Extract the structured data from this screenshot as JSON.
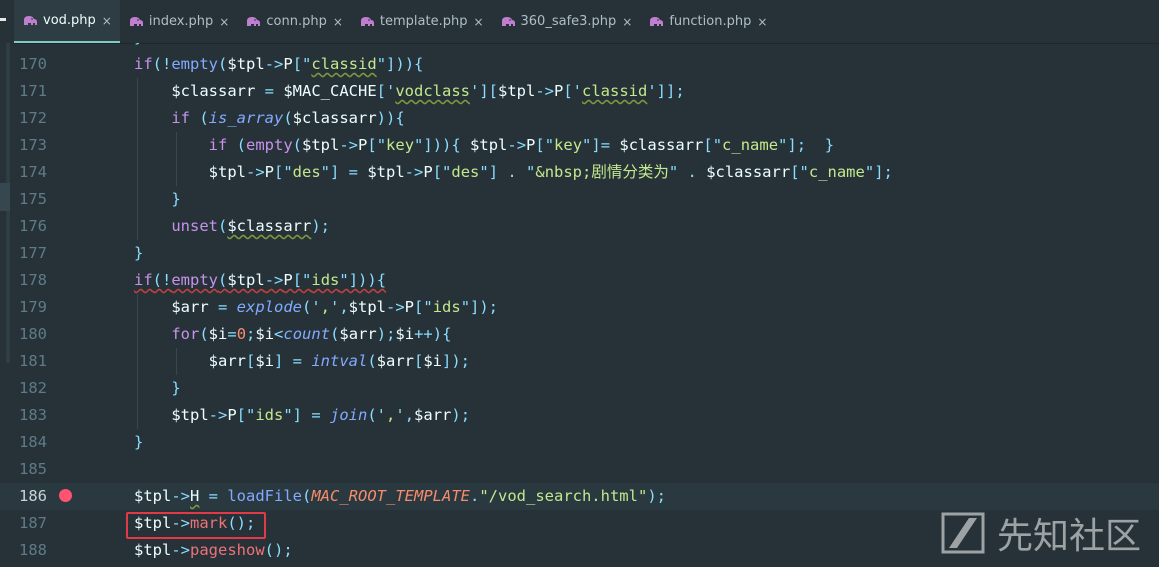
{
  "tabs": [
    {
      "label": "vod.php",
      "active": true
    },
    {
      "label": "index.php",
      "active": false
    },
    {
      "label": "conn.php",
      "active": false
    },
    {
      "label": "template.php",
      "active": false
    },
    {
      "label": "360_safe3.php",
      "active": false
    },
    {
      "label": "function.php",
      "active": false
    }
  ],
  "tab_close_glyph": "×",
  "lines": [
    {
      "num": "170",
      "tokens": [
        [
          "k",
          "if"
        ],
        [
          "o",
          "(!"
        ],
        [
          "f",
          "empty"
        ],
        [
          "o",
          "("
        ],
        [
          "v",
          "$tpl"
        ],
        [
          "o",
          "->"
        ],
        [
          "v",
          "P"
        ],
        [
          "o",
          "[\""
        ],
        [
          "s u",
          "classid"
        ],
        [
          "o",
          "\"])){"
        ]
      ]
    },
    {
      "num": "171",
      "tokens": [
        [
          "v",
          "    $classarr"
        ],
        [
          "o",
          " = "
        ],
        [
          "v",
          "$MAC_CACHE"
        ],
        [
          "o",
          "['"
        ],
        [
          "s u",
          "vodclass"
        ],
        [
          "o",
          "']["
        ],
        [
          "v",
          "$tpl"
        ],
        [
          "o",
          "->"
        ],
        [
          "v",
          "P"
        ],
        [
          "o",
          "['"
        ],
        [
          "s u",
          "classid"
        ],
        [
          "o",
          "']];"
        ]
      ]
    },
    {
      "num": "172",
      "tokens": [
        [
          "k",
          "    if"
        ],
        [
          "o",
          " ("
        ],
        [
          "fi",
          "is_array"
        ],
        [
          "o",
          "("
        ],
        [
          "v",
          "$classarr"
        ],
        [
          "o",
          "))"
        ],
        [
          "o",
          "{"
        ]
      ]
    },
    {
      "num": "173",
      "tokens": [
        [
          "k",
          "        if"
        ],
        [
          "o",
          " ("
        ],
        [
          "k",
          "empty"
        ],
        [
          "o",
          "("
        ],
        [
          "v",
          "$tpl"
        ],
        [
          "o",
          "->"
        ],
        [
          "v",
          "P"
        ],
        [
          "o",
          "[\""
        ],
        [
          "s",
          "key"
        ],
        [
          "o",
          "\"])){ "
        ],
        [
          "v",
          "$tpl"
        ],
        [
          "o",
          "->"
        ],
        [
          "v",
          "P"
        ],
        [
          "o",
          "[\""
        ],
        [
          "s",
          "key"
        ],
        [
          "o",
          "\"]= "
        ],
        [
          "v",
          "$classarr"
        ],
        [
          "o",
          "[\""
        ],
        [
          "s",
          "c_name"
        ],
        [
          "o",
          "\"];  }"
        ]
      ]
    },
    {
      "num": "174",
      "tokens": [
        [
          "v",
          "        $tpl"
        ],
        [
          "o",
          "->"
        ],
        [
          "v",
          "P"
        ],
        [
          "o",
          "[\""
        ],
        [
          "s",
          "des"
        ],
        [
          "o",
          "\"] = "
        ],
        [
          "v",
          "$tpl"
        ],
        [
          "o",
          "->"
        ],
        [
          "v",
          "P"
        ],
        [
          "o",
          "[\""
        ],
        [
          "s",
          "des"
        ],
        [
          "o",
          "\"] . \""
        ],
        [
          "s",
          "&nbsp;剧情分类为"
        ],
        [
          "o",
          "\" . "
        ],
        [
          "v",
          "$classarr"
        ],
        [
          "o",
          "[\""
        ],
        [
          "s",
          "c_name"
        ],
        [
          "o",
          "\"];"
        ]
      ]
    },
    {
      "num": "175",
      "tokens": [
        [
          "o",
          "    }"
        ]
      ]
    },
    {
      "num": "176",
      "tokens": [
        [
          "k",
          "    unset"
        ],
        [
          "o",
          "("
        ],
        [
          "v u",
          "$classarr"
        ],
        [
          "o",
          ");"
        ]
      ]
    },
    {
      "num": "177",
      "tokens": [
        [
          "o",
          "}"
        ]
      ]
    },
    {
      "num": "178",
      "tokens": [
        [
          "k ue",
          "if"
        ],
        [
          "o ue",
          "(!"
        ],
        [
          "k ue",
          "empty"
        ],
        [
          "o ue",
          "("
        ],
        [
          "v ue",
          "$tpl"
        ],
        [
          "o ue",
          "->"
        ],
        [
          "v ue",
          "P"
        ],
        [
          "o ue",
          "[\""
        ],
        [
          "s ue",
          "ids"
        ],
        [
          "o ue",
          "\"])){"
        ]
      ]
    },
    {
      "num": "179",
      "tokens": [
        [
          "v",
          "    $arr"
        ],
        [
          "o",
          " = "
        ],
        [
          "fi",
          "explode"
        ],
        [
          "o",
          "('"
        ],
        [
          "s",
          ","
        ],
        [
          "o",
          "',"
        ],
        [
          "v",
          "$tpl"
        ],
        [
          "o",
          "->"
        ],
        [
          "v",
          "P"
        ],
        [
          "o",
          "[\""
        ],
        [
          "s",
          "ids"
        ],
        [
          "o",
          "\"]);"
        ]
      ]
    },
    {
      "num": "180",
      "tokens": [
        [
          "k",
          "    for"
        ],
        [
          "o",
          "("
        ],
        [
          "v",
          "$i"
        ],
        [
          "o",
          "="
        ],
        [
          "n",
          "0"
        ],
        [
          "o",
          ";"
        ],
        [
          "v",
          "$i"
        ],
        [
          "o",
          "<"
        ],
        [
          "fi",
          "count"
        ],
        [
          "o",
          "("
        ],
        [
          "v",
          "$arr"
        ],
        [
          "o",
          ");"
        ],
        [
          "v",
          "$i"
        ],
        [
          "o",
          "++){"
        ]
      ]
    },
    {
      "num": "181",
      "tokens": [
        [
          "v",
          "        $arr"
        ],
        [
          "o",
          "["
        ],
        [
          "v",
          "$i"
        ],
        [
          "o",
          "] = "
        ],
        [
          "fi",
          "intval"
        ],
        [
          "o",
          "("
        ],
        [
          "v",
          "$arr"
        ],
        [
          "o",
          "["
        ],
        [
          "v",
          "$i"
        ],
        [
          "o",
          "]);"
        ]
      ]
    },
    {
      "num": "182",
      "tokens": [
        [
          "o",
          "    }"
        ]
      ]
    },
    {
      "num": "183",
      "tokens": [
        [
          "v",
          "    $tpl"
        ],
        [
          "o",
          "->"
        ],
        [
          "v",
          "P"
        ],
        [
          "o",
          "[\""
        ],
        [
          "s",
          "ids"
        ],
        [
          "o",
          "\"] = "
        ],
        [
          "fi",
          "join"
        ],
        [
          "o",
          "('"
        ],
        [
          "s",
          ","
        ],
        [
          "o",
          "',"
        ],
        [
          "v",
          "$arr"
        ],
        [
          "o",
          ");"
        ]
      ]
    },
    {
      "num": "184",
      "tokens": [
        [
          "o",
          "}"
        ]
      ]
    },
    {
      "num": "185",
      "tokens": []
    },
    {
      "num": "186",
      "tokens": [
        [
          "v",
          "$tpl"
        ],
        [
          "o",
          "->"
        ],
        [
          "v u",
          "H"
        ],
        [
          "o",
          " = "
        ],
        [
          "f",
          "loadFile"
        ],
        [
          "o",
          "("
        ],
        [
          "c",
          "MAC_ROOT_TEMPLATE"
        ],
        [
          "o",
          "."
        ],
        [
          "s",
          "\"/vod_search.html\""
        ],
        [
          "o",
          ");"
        ]
      ]
    },
    {
      "num": "187",
      "tokens": [
        [
          "v",
          "$tpl"
        ],
        [
          "o",
          "->"
        ],
        [
          "m",
          "mark"
        ],
        [
          "o",
          "();"
        ]
      ]
    },
    {
      "num": "188",
      "tokens": [
        [
          "v",
          "$tpl"
        ],
        [
          "o",
          "->"
        ],
        [
          "m",
          "pageshow"
        ],
        [
          "o",
          "();"
        ]
      ]
    }
  ],
  "partial_top_line": "169",
  "breakpoint_line": "186",
  "current_line": "186",
  "highlighted_line": "187",
  "watermark": {
    "text": "先知社区"
  },
  "colors": {
    "background": "#263238",
    "keyword": "#c792ea",
    "string": "#c3e88d",
    "function": "#82aaff",
    "constant": "#f78c6c",
    "method": "#f07178",
    "breakpoint": "#ff5370",
    "highlight_box": "#e03a48"
  },
  "icons": {
    "tab_file_icon": "php-elephant-icon",
    "close_icon": "close-icon",
    "breakpoint_icon": "breakpoint-dot-icon"
  }
}
